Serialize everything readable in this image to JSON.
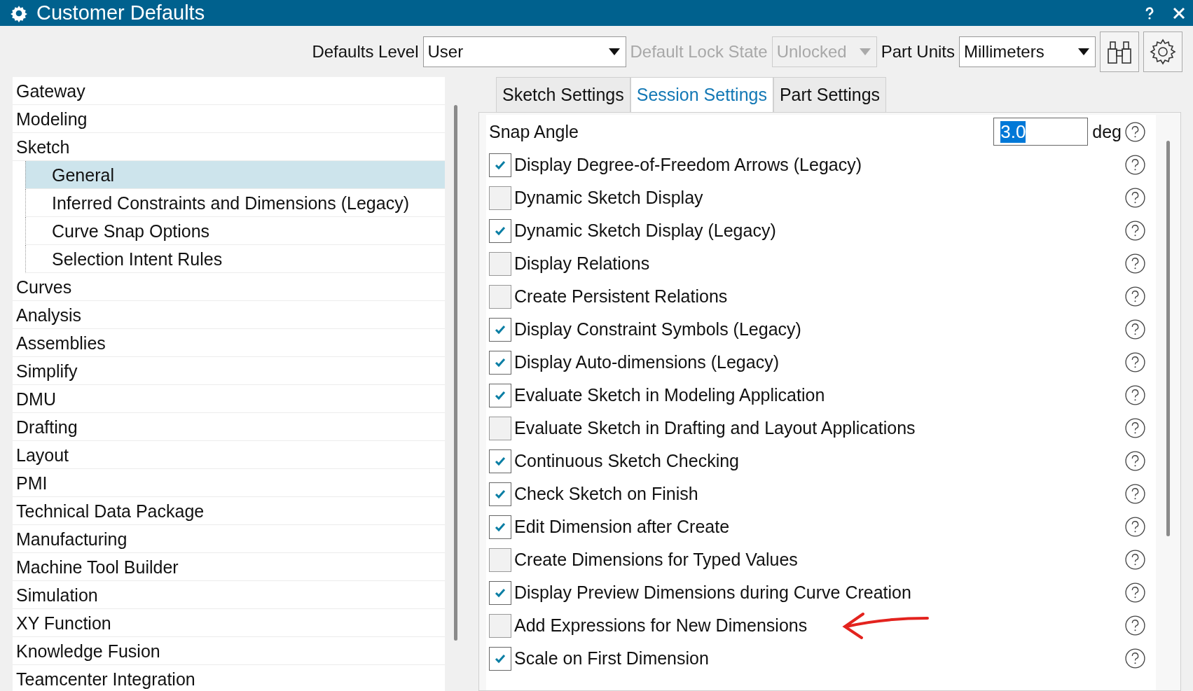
{
  "window": {
    "title": "Customer Defaults"
  },
  "toolbar": {
    "defaults_level": {
      "label": "Defaults Level",
      "value": "User",
      "disabled": false
    },
    "lock_state": {
      "label": "Default Lock State",
      "value": "Unlocked",
      "disabled": true
    },
    "part_units": {
      "label": "Part Units",
      "value": "Millimeters",
      "disabled": false
    }
  },
  "tree": [
    {
      "label": "Gateway",
      "selected": false
    },
    {
      "label": "Modeling",
      "selected": false
    },
    {
      "label": "Sketch",
      "selected": false,
      "children": [
        {
          "label": "General",
          "selected": true
        },
        {
          "label": "Inferred Constraints and Dimensions (Legacy)",
          "selected": false
        },
        {
          "label": "Curve Snap Options",
          "selected": false
        },
        {
          "label": "Selection Intent Rules",
          "selected": false
        }
      ]
    },
    {
      "label": "Curves",
      "selected": false
    },
    {
      "label": "Analysis",
      "selected": false
    },
    {
      "label": "Assemblies",
      "selected": false
    },
    {
      "label": "Simplify",
      "selected": false
    },
    {
      "label": "DMU",
      "selected": false
    },
    {
      "label": "Drafting",
      "selected": false
    },
    {
      "label": "Layout",
      "selected": false
    },
    {
      "label": "PMI",
      "selected": false
    },
    {
      "label": "Technical Data Package",
      "selected": false
    },
    {
      "label": "Manufacturing",
      "selected": false
    },
    {
      "label": "Machine Tool Builder",
      "selected": false
    },
    {
      "label": "Simulation",
      "selected": false
    },
    {
      "label": "XY Function",
      "selected": false
    },
    {
      "label": "Knowledge Fusion",
      "selected": false
    },
    {
      "label": "Teamcenter Integration",
      "selected": false
    }
  ],
  "tabs": [
    {
      "label": "Sketch Settings",
      "selected": false
    },
    {
      "label": "Session Settings",
      "selected": true
    },
    {
      "label": "Part Settings",
      "selected": false
    }
  ],
  "settings": [
    {
      "kind": "number",
      "label": "Snap Angle",
      "value": "3.0",
      "unit": "deg"
    },
    {
      "kind": "checkbox",
      "label": "Display Degree-of-Freedom Arrows (Legacy)",
      "checked": true
    },
    {
      "kind": "checkbox",
      "label": "Dynamic Sketch Display",
      "checked": false
    },
    {
      "kind": "checkbox",
      "label": "Dynamic Sketch Display (Legacy)",
      "checked": true
    },
    {
      "kind": "checkbox",
      "label": "Display Relations",
      "checked": false
    },
    {
      "kind": "checkbox",
      "label": "Create Persistent Relations",
      "checked": false
    },
    {
      "kind": "checkbox",
      "label": "Display Constraint Symbols (Legacy)",
      "checked": true
    },
    {
      "kind": "checkbox",
      "label": "Display Auto-dimensions (Legacy)",
      "checked": true
    },
    {
      "kind": "checkbox",
      "label": "Evaluate Sketch in Modeling Application",
      "checked": true
    },
    {
      "kind": "checkbox",
      "label": "Evaluate Sketch in Drafting and Layout Applications",
      "checked": false
    },
    {
      "kind": "checkbox",
      "label": "Continuous Sketch Checking",
      "checked": true
    },
    {
      "kind": "checkbox",
      "label": "Check Sketch on Finish",
      "checked": true
    },
    {
      "kind": "checkbox",
      "label": "Edit Dimension after Create",
      "checked": true
    },
    {
      "kind": "checkbox",
      "label": "Create Dimensions for Typed Values",
      "checked": false
    },
    {
      "kind": "checkbox",
      "label": "Display Preview Dimensions during Curve Creation",
      "checked": true
    },
    {
      "kind": "checkbox",
      "label": "Add Expressions for New Dimensions",
      "checked": false,
      "annotated": true
    },
    {
      "kind": "checkbox",
      "label": "Scale on First Dimension",
      "checked": true
    }
  ]
}
